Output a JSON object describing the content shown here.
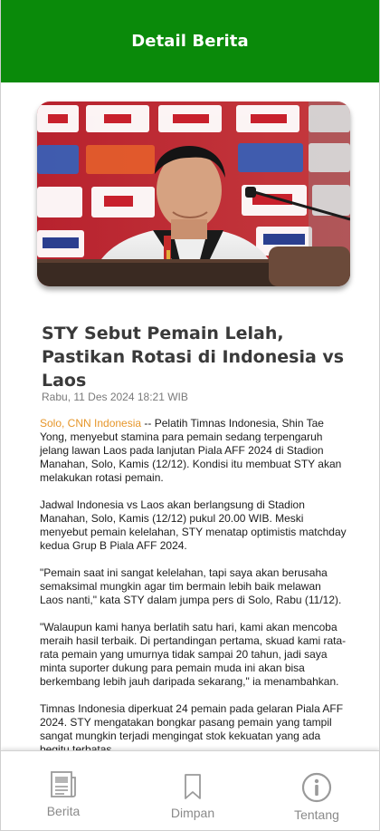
{
  "header": {
    "title": "Detail Berita"
  },
  "article": {
    "image_alt": "Shin Tae Yong at press conference",
    "headline": "STY Sebut Pemain Lelah, Pastikan Rotasi di Indonesia vs Laos",
    "date": "Rabu, 11 Des 2024 18:21 WIB",
    "source": "Solo, CNN Indonesia",
    "paragraphs": [
      " -- Pelatih Timnas Indonesia, Shin Tae Yong, menyebut stamina para pemain sedang terpengaruh jelang lawan Laos pada lanjutan Piala AFF 2024 di Stadion Manahan, Solo, Kamis (12/12). Kondisi itu membuat STY akan melakukan rotasi pemain.",
      "Jadwal Indonesia vs Laos akan berlangsung di Stadion Manahan, Solo, Kamis (12/12) pukul 20.00 WIB. Meski menyebut pemain kelelahan, STY menatap optimistis matchday kedua Grup B Piala AFF 2024.",
      "\"Pemain saat ini sangat kelelahan, tapi saya akan berusaha semaksimal mungkin agar tim bermain lebih baik melawan Laos nanti,\" kata STY dalam jumpa pers di Solo, Rabu (11/12).",
      "\"Walaupun kami hanya berlatih satu hari, kami akan mencoba meraih hasil terbaik. Di pertandingan pertama, skuad kami rata-rata pemain yang umurnya tidak sampai 20 tahun, jadi saya minta suporter dukung para pemain muda ini akan bisa berkembang lebih jauh daripada sekarang,\" ia menambahkan.",
      "Timnas Indonesia diperkuat 24 pemain pada gelaran Piala AFF 2024. STY mengatakan bongkar pasang pemain yang tampil sangat mungkin terjadi mengingat stok kekuatan yang ada begitu terbatas."
    ]
  },
  "nav": {
    "items": [
      {
        "label": "Berita",
        "icon": "newspaper-icon"
      },
      {
        "label": "Dimpan",
        "icon": "bookmark-icon"
      },
      {
        "label": "Tentang",
        "icon": "info-icon"
      }
    ]
  },
  "colors": {
    "header_bg": "#0a8a0a",
    "source_link": "#e6962a"
  }
}
